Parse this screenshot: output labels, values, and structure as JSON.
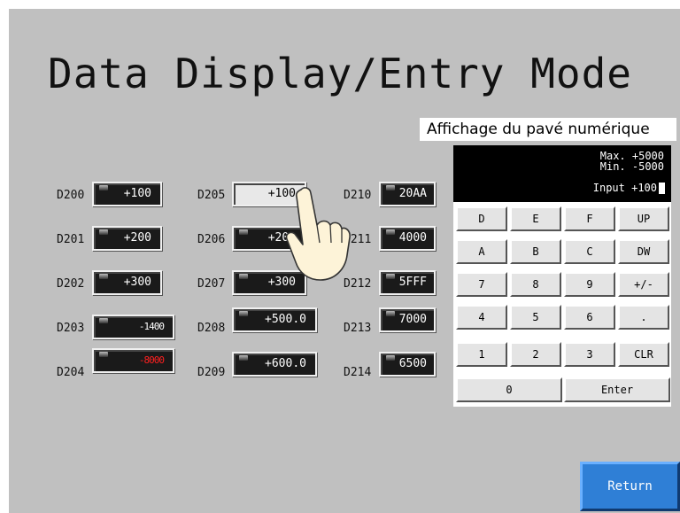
{
  "screen": {
    "title": "Data Display/Entry Mode",
    "caption": "Affichage du pavé numérique"
  },
  "registers": [
    {
      "label": "D200",
      "value": "+100"
    },
    {
      "label": "D201",
      "value": "+200"
    },
    {
      "label": "D202",
      "value": "+300"
    },
    {
      "label": "D203",
      "value": "-1400"
    },
    {
      "label": "D204",
      "value": "-8000"
    },
    {
      "label": "D205",
      "value": "+100"
    },
    {
      "label": "D206",
      "value": "+200"
    },
    {
      "label": "D207",
      "value": "+300"
    },
    {
      "label": "D208",
      "value": "+500.0"
    },
    {
      "label": "D209",
      "value": "+600.0"
    },
    {
      "label": "D210",
      "value": "20AA"
    },
    {
      "label": "D211",
      "value": "4000"
    },
    {
      "label": "D212",
      "value": "5FFF"
    },
    {
      "label": "D213",
      "value": "7000"
    },
    {
      "label": "D214",
      "value": "6500"
    }
  ],
  "keypad": {
    "max_label": "Max. +5000",
    "min_label": "Min. -5000",
    "input_label": "Input +100",
    "keys": [
      "D",
      "E",
      "F",
      "UP",
      "A",
      "B",
      "C",
      "DW",
      "7",
      "8",
      "9",
      "+/-",
      "4",
      "5",
      "6",
      ".",
      "1",
      "2",
      "3",
      "CLR",
      "0",
      "Enter"
    ]
  },
  "return_label": "Return",
  "colors": {
    "panel": "#c0c0c0",
    "display": "#1a1a1a",
    "accent": "#2f7fd6",
    "negative": "#ff2020"
  }
}
